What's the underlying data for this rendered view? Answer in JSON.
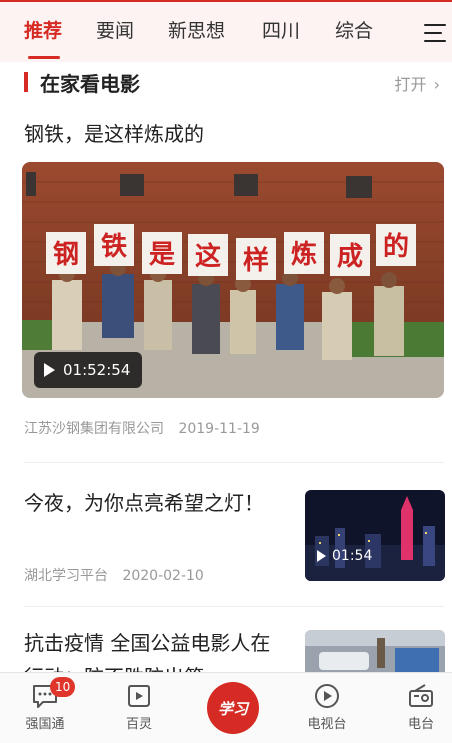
{
  "tabs": [
    {
      "label": "推荐",
      "active": true
    },
    {
      "label": "要闻"
    },
    {
      "label": "新思想"
    },
    {
      "label": "四川"
    },
    {
      "label": "综合"
    }
  ],
  "section": {
    "title": "在家看电影",
    "open_label": "打开"
  },
  "movie": {
    "title": "钢铁，是这样炼成的",
    "duration": "01:52:54",
    "signs": [
      "钢",
      "铁",
      "是",
      "这",
      "样",
      "炼",
      "成",
      "的"
    ],
    "source": "江苏沙钢集团有限公司",
    "date": "2019-11-19"
  },
  "articles": [
    {
      "title": "今夜，为你点亮希望之灯！",
      "source": "湖北学习平台",
      "date": "2020-02-10",
      "duration": "01:54"
    },
    {
      "title": "抗击疫情 全国公益电影人在行动：防不胜防出第"
    }
  ],
  "bottom_nav": [
    {
      "label": "强国通",
      "icon": "chat-icon",
      "badge": "10"
    },
    {
      "label": "百灵",
      "icon": "video-play-icon"
    },
    {
      "label": "学习",
      "icon": "xuexi-logo"
    },
    {
      "label": "电视台",
      "icon": "play-circle-icon"
    },
    {
      "label": "电台",
      "icon": "radio-icon"
    }
  ],
  "colors": {
    "accent": "#d62b24",
    "muted": "#999999"
  }
}
